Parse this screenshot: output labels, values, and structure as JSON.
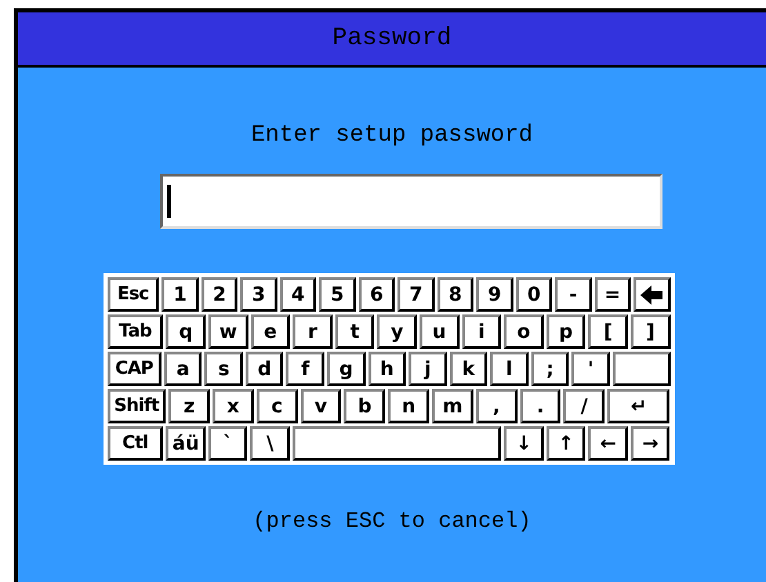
{
  "window": {
    "title": "Password"
  },
  "prompt": "Enter setup password",
  "keyboard": {
    "rows": [
      {
        "keys": [
          {
            "kind": "mod",
            "label": "Esc"
          },
          {
            "kind": "key",
            "label": "1"
          },
          {
            "kind": "key",
            "label": "2"
          },
          {
            "kind": "key",
            "label": "3"
          },
          {
            "kind": "key",
            "label": "4"
          },
          {
            "kind": "key",
            "label": "5"
          },
          {
            "kind": "key",
            "label": "6"
          },
          {
            "kind": "key",
            "label": "7"
          },
          {
            "kind": "key",
            "label": "8"
          },
          {
            "kind": "key",
            "label": "9"
          },
          {
            "kind": "key",
            "label": "0"
          },
          {
            "kind": "key",
            "label": "-"
          },
          {
            "kind": "key",
            "label": "="
          },
          {
            "kind": "backspace"
          }
        ]
      },
      {
        "keys": [
          {
            "kind": "mod",
            "label": "Tab"
          },
          {
            "kind": "key",
            "label": "q"
          },
          {
            "kind": "key",
            "label": "w"
          },
          {
            "kind": "key",
            "label": "e"
          },
          {
            "kind": "key",
            "label": "r"
          },
          {
            "kind": "key",
            "label": "t"
          },
          {
            "kind": "key",
            "label": "y"
          },
          {
            "kind": "key",
            "label": "u"
          },
          {
            "kind": "key",
            "label": "i"
          },
          {
            "kind": "key",
            "label": "o"
          },
          {
            "kind": "key",
            "label": "p"
          },
          {
            "kind": "key",
            "label": "["
          },
          {
            "kind": "key",
            "label": "]"
          }
        ]
      },
      {
        "keys": [
          {
            "kind": "mod",
            "label": "CAP"
          },
          {
            "kind": "key",
            "label": "a"
          },
          {
            "kind": "key",
            "label": "s"
          },
          {
            "kind": "key",
            "label": "d"
          },
          {
            "kind": "key",
            "label": "f"
          },
          {
            "kind": "key",
            "label": "g"
          },
          {
            "kind": "key",
            "label": "h"
          },
          {
            "kind": "key",
            "label": "j"
          },
          {
            "kind": "key",
            "label": "k"
          },
          {
            "kind": "key",
            "label": "l"
          },
          {
            "kind": "key",
            "label": ";"
          },
          {
            "kind": "key",
            "label": "'"
          },
          {
            "kind": "blank"
          }
        ]
      },
      {
        "keys": [
          {
            "kind": "mod",
            "label": "Shift"
          },
          {
            "kind": "key",
            "label": "z"
          },
          {
            "kind": "key",
            "label": "x"
          },
          {
            "kind": "key",
            "label": "c"
          },
          {
            "kind": "key",
            "label": "v"
          },
          {
            "kind": "key",
            "label": "b"
          },
          {
            "kind": "key",
            "label": "n"
          },
          {
            "kind": "key",
            "label": "m"
          },
          {
            "kind": "key",
            "label": ","
          },
          {
            "kind": "key",
            "label": "."
          },
          {
            "kind": "key",
            "label": "/"
          },
          {
            "kind": "wide",
            "label": "↵"
          }
        ]
      },
      {
        "keys": [
          {
            "kind": "mod",
            "label": "Ctl"
          },
          {
            "kind": "key",
            "label": "áü"
          },
          {
            "kind": "key",
            "label": "`"
          },
          {
            "kind": "key",
            "label": "\\"
          },
          {
            "kind": "space"
          },
          {
            "kind": "key",
            "label": "↓"
          },
          {
            "kind": "key",
            "label": "↑"
          },
          {
            "kind": "key",
            "label": "←"
          },
          {
            "kind": "key",
            "label": "→"
          }
        ]
      }
    ]
  },
  "hint": "(press ESC to cancel)"
}
